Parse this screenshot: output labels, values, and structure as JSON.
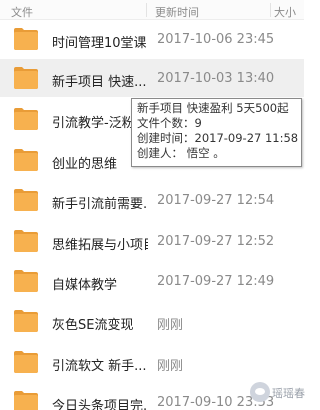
{
  "header": {
    "name_label": "文件",
    "time_label": "更新时间",
    "size_label": "大小"
  },
  "files": [
    {
      "name": "时间管理10堂课",
      "time": "2017-10-06 23:45"
    },
    {
      "name": "新手项目 快速...",
      "time": "2017-10-03 13:40"
    },
    {
      "name": "引流教学-泛粉...",
      "time": ""
    },
    {
      "name": "创业的思维",
      "time": ""
    },
    {
      "name": "新手引流前需要...",
      "time": "2017-09-27 12:54"
    },
    {
      "name": "思维拓展与小项目",
      "time": "2017-09-27 12:52"
    },
    {
      "name": "自媒体教学",
      "time": "2017-09-27 12:49"
    },
    {
      "name": "灰色SE流变现",
      "time": "刚刚"
    },
    {
      "name": "引流软文 新手...",
      "time": "刚刚"
    },
    {
      "name": "今日头条项目完...",
      "time": "2017-09-10 23:53"
    }
  ],
  "tooltip": {
    "title": "新手项目 快速盈利  5天500起",
    "count": "文件个数：9",
    "created": "创建时间：2017-09-27 11:58",
    "creator": "创建人：       悟空 。"
  },
  "watermark": {
    "text": "瑶瑶春"
  },
  "colors": {
    "folder": "#f7b14f",
    "folder_tab": "#e99c37",
    "selected_row": "#efefef"
  }
}
